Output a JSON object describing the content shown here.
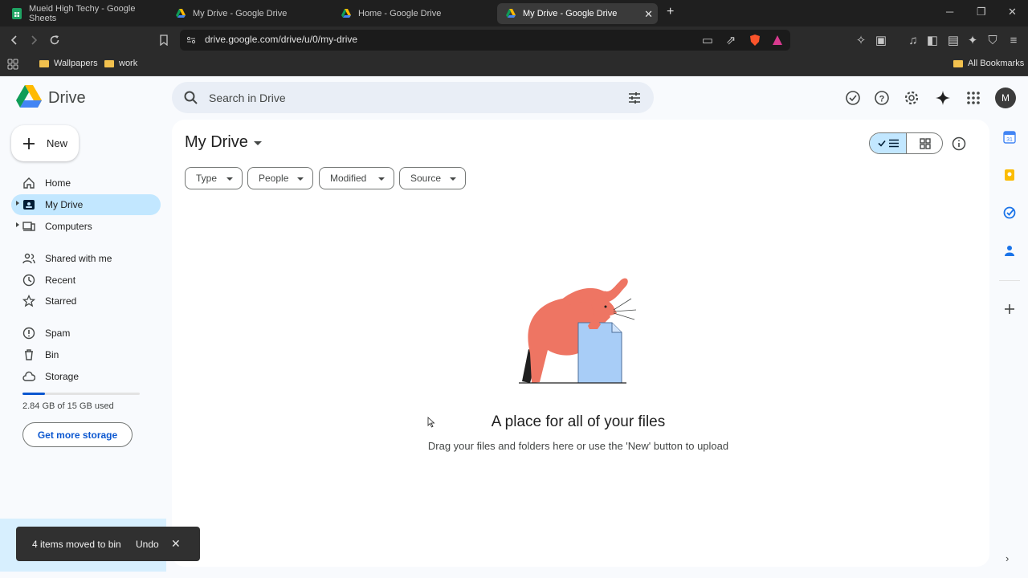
{
  "browser": {
    "tabs": [
      {
        "title": "Mueid High Techy - Google Sheets",
        "favicon": "sheets-icon",
        "active": false
      },
      {
        "title": "My Drive - Google Drive",
        "favicon": "drive-icon",
        "active": false
      },
      {
        "title": "Home - Google Drive",
        "favicon": "drive-icon",
        "active": false
      },
      {
        "title": "My Drive - Google Drive",
        "favicon": "drive-icon",
        "active": true
      }
    ],
    "url": "drive.google.com/drive/u/0/my-drive",
    "bookmarks": [
      {
        "label": "Wallpapers"
      },
      {
        "label": "work"
      }
    ],
    "all_bookmarks": "All Bookmarks"
  },
  "header": {
    "app_name": "Drive",
    "search_placeholder": "Search in Drive",
    "avatar_initial": "M"
  },
  "sidebar": {
    "new_label": "New",
    "items": [
      {
        "label": "Home",
        "icon": "home-icon"
      },
      {
        "label": "My Drive",
        "icon": "my-drive-icon",
        "active": true
      },
      {
        "label": "Computers",
        "icon": "computer-icon"
      },
      {
        "label": "Shared with me",
        "icon": "people-icon"
      },
      {
        "label": "Recent",
        "icon": "clock-icon"
      },
      {
        "label": "Starred",
        "icon": "star-icon"
      },
      {
        "label": "Spam",
        "icon": "spam-icon"
      },
      {
        "label": "Bin",
        "icon": "trash-icon"
      },
      {
        "label": "Storage",
        "icon": "cloud-icon"
      }
    ],
    "storage_text": "2.84 GB of 15 GB used",
    "storage_used_fraction": 0.19,
    "get_storage_label": "Get more storage"
  },
  "main": {
    "title": "My Drive",
    "filters": [
      "Type",
      "People",
      "Modified",
      "Source"
    ],
    "empty_title": "A place for all of your files",
    "empty_subtitle": "Drag your files and folders here or use the 'New' button to upload"
  },
  "snackbar": {
    "message": "4 items moved to bin",
    "undo_label": "Undo"
  },
  "colors": {
    "accent_blue": "#0b57d0",
    "active_nav": "#c2e7ff",
    "page_bg": "#f8fafd"
  }
}
